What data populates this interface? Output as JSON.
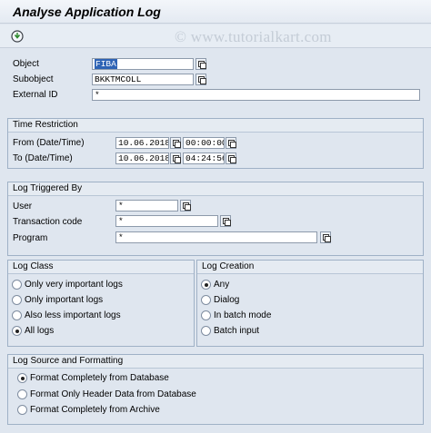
{
  "window": {
    "title": "Analyse Application Log"
  },
  "toolbar": {
    "watermark": "© www.tutorialkart.com",
    "execute_icon": "execute-icon"
  },
  "selection": {
    "object_label": "Object",
    "object_value": "FIBA",
    "subobject_label": "Subobject",
    "subobject_value": "BKKTMCOLL",
    "external_id_label": "External ID",
    "external_id_value": "*"
  },
  "time_restriction": {
    "title": "Time Restriction",
    "from_label": "From (Date/Time)",
    "from_date": "10.06.2018",
    "from_time": "00:00:00",
    "to_label": "To (Date/Time)",
    "to_date": "10.06.2018",
    "to_time": "04:24:56"
  },
  "log_triggered_by": {
    "title": "Log Triggered By",
    "user_label": "User",
    "user_value": "*",
    "tcode_label": "Transaction code",
    "tcode_value": "*",
    "program_label": "Program",
    "program_value": "*"
  },
  "log_class": {
    "title": "Log Class",
    "options": [
      "Only very important logs",
      "Only important logs",
      "Also less important logs",
      "All logs"
    ],
    "selected_index": 3
  },
  "log_creation": {
    "title": "Log Creation",
    "options": [
      "Any",
      "Dialog",
      "In batch mode",
      "Batch input"
    ],
    "selected_index": 0
  },
  "log_source": {
    "title": "Log Source and Formatting",
    "options": [
      "Format Completely from Database",
      "Format Only Header Data from Database",
      "Format Completely from Archive"
    ],
    "selected_index": 0
  }
}
